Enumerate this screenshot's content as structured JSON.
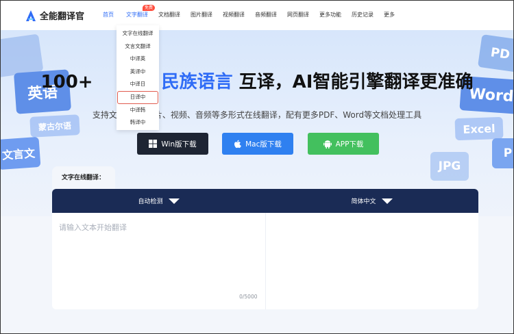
{
  "app": {
    "name": "全能翻译官"
  },
  "nav": {
    "items": [
      {
        "label": "首页"
      },
      {
        "label": "文字翻译",
        "badge": "免费"
      },
      {
        "label": "文档翻译"
      },
      {
        "label": "图片翻译"
      },
      {
        "label": "视频翻译"
      },
      {
        "label": "音频翻译"
      },
      {
        "label": "网页翻译"
      },
      {
        "label": "更多功能"
      },
      {
        "label": "历史记录"
      },
      {
        "label": "更多"
      }
    ]
  },
  "dropdown": {
    "items": [
      "文字在线翻译",
      "文言文翻译",
      "中译英",
      "英译中",
      "中译日",
      "日译中",
      "中译韩",
      "韩译中"
    ],
    "highlighted": "日译中"
  },
  "hero": {
    "title_part1": "100+",
    "title_part2": "民族语言",
    "title_part3": "互译，AI智能引擎翻译更准确",
    "subtitle_left": "支持文",
    "subtitle_right": "图片、视频、音频等多形式在线翻译，配有更多PDF、Word等文档处理工具",
    "deco_words": [
      "英语",
      "蒙古尔语",
      "文言文",
      "PD",
      "Word",
      "Excel",
      "JPG",
      "P"
    ]
  },
  "downloads": {
    "win": "Win版下载",
    "mac": "Mac版下载",
    "app": "APP下载"
  },
  "translator": {
    "tab_label": "文字在线翻译：",
    "source_lang": "自动检测",
    "target_lang": "简体中文",
    "placeholder": "请输入文本开始翻译",
    "counter": "0/5000"
  },
  "colors": {
    "accent": "#2f6cf6",
    "dark_header": "#1a2b55",
    "highlight_border": "#e05a4e",
    "win_btn": "#1e2533",
    "mac_btn": "#2f80f0",
    "app_btn": "#43c05e"
  }
}
